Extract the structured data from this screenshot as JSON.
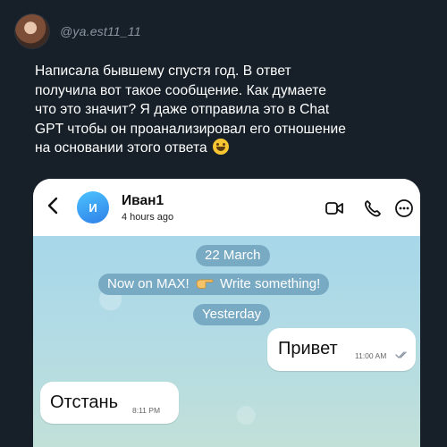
{
  "post": {
    "username": "@ya.est11_11",
    "text_lines": [
      "Написала бывшему спустя год. В ответ",
      "получила вот такое сообщение. Как думаете",
      "что это значит? Я даже отправила это в Chat",
      "GPT чтобы он проанализировал его отношение",
      "на основании этого ответа"
    ],
    "emoji": "smiling-face-emoji"
  },
  "chat": {
    "header": {
      "avatar_initial": "И",
      "contact_name": "Иван1",
      "last_seen": "4 hours ago"
    },
    "pills": {
      "date1": "22 March",
      "notice_part1": "Now on MAX!",
      "notice_part2": "Write something!",
      "date2": "Yesterday"
    },
    "messages": {
      "outgoing": {
        "text": "Привет",
        "time": "11:00 AM"
      },
      "incoming": {
        "text": "Отстань",
        "time": "8:11 PM"
      }
    }
  },
  "colors": {
    "page_background": "#172029",
    "chat_background": "#b2dbe5",
    "pill": "#78aac3",
    "accent_blue": "#2f7fe8"
  },
  "icons": [
    "back-icon",
    "video-call-icon",
    "phone-call-icon",
    "more-icon",
    "pointing-hand-icon",
    "double-check-icon"
  ]
}
